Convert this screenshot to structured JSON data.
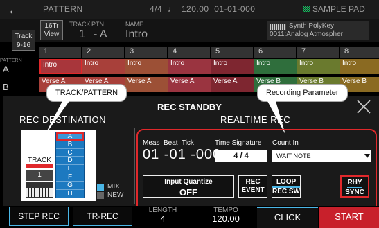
{
  "header": {
    "title": "PATTERN",
    "info": "4/4  ♩=120.00  01-01-000",
    "pad": "SAMPLE PAD"
  },
  "info": {
    "view_button": [
      "16Tr",
      "View"
    ],
    "track_label": "TRACK",
    "track_value": "1",
    "ptn_label": "PTN",
    "ptn_value": "- A",
    "name_label": "NAME",
    "name_value": "Intro",
    "track_range": [
      "Track",
      "9-16"
    ],
    "synth": [
      "Synth PolyKey",
      "0011:Analog Atmospher"
    ]
  },
  "track_numbers": [
    "1",
    "2",
    "3",
    "4",
    "5",
    "6",
    "7",
    "8"
  ],
  "rows": {
    "label": "PATTERN",
    "a": "A",
    "b": "B",
    "a_cells": [
      "Intro",
      "Intro",
      "Intro",
      "Intro",
      "Intro",
      "Intro",
      "Intro",
      "Intro"
    ],
    "b_cells": [
      "Verse A",
      "Verse A",
      "Verse A",
      "Verse A",
      "Verse A",
      "Verse B",
      "Verse B",
      "Verse B"
    ]
  },
  "callouts": {
    "track_pattern": "TRACK/PATTERN",
    "recording_parameter": "Recording Parameter"
  },
  "dialog": {
    "title": "REC STANDBY",
    "rec_destination": "REC DESTINATION",
    "realtime_rec": "REALTIME REC",
    "track_label": "TRACK",
    "track_value": "1",
    "patterns": [
      "A",
      "B",
      "C",
      "D",
      "E",
      "F",
      "G",
      "H"
    ],
    "mix": "MIX",
    "new": "NEW",
    "meas_beat_tick_labels": "Meas  Beat  Tick",
    "meas_beat_tick_value": "01 -01 -000",
    "time_signature_label": "Time Signature",
    "time_signature_value": "4 / 4",
    "count_in_label": "Count In",
    "count_in_value": "WAIT NOTE",
    "input_quantize_label": "Input Quantize",
    "input_quantize_value": "OFF",
    "rec_event": [
      "REC",
      "EVENT"
    ],
    "loop_rec_sw": [
      "LOOP",
      "REC SW"
    ],
    "rhy_sync": [
      "RHY",
      "SYNC"
    ]
  },
  "bottom": {
    "step_rec": "STEP REC",
    "tr_rec": "TR-REC",
    "length_label": "LENGTH",
    "length_value": "4",
    "tempo_label": "TEMPO",
    "tempo_value": "120.00",
    "click": "CLICK",
    "start": "START"
  },
  "colors": {
    "accent_red": "#e0282b",
    "accent_blue": "#4ab6e6",
    "pattern_blue": "#1c79c0"
  }
}
